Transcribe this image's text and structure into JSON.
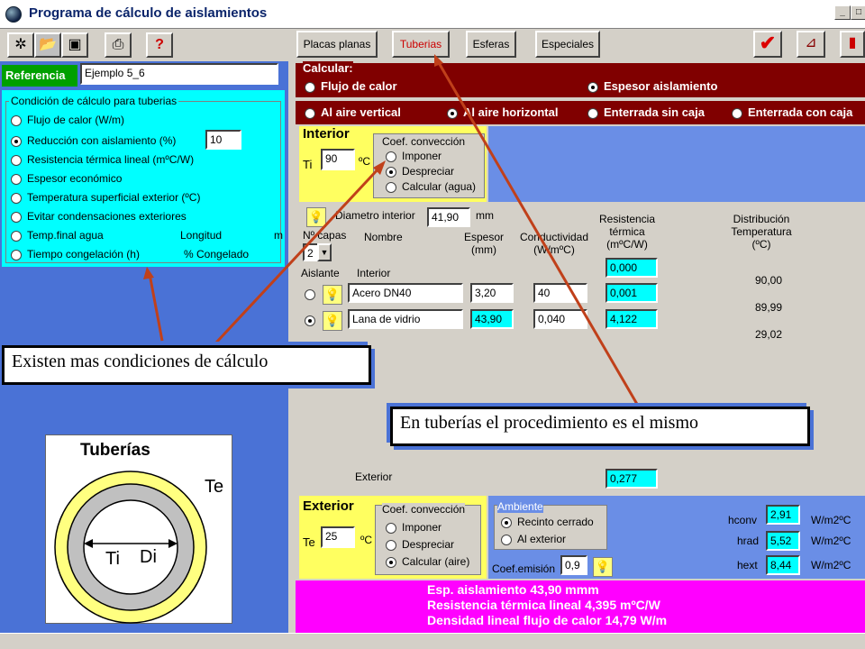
{
  "window": {
    "title": "Programa de cálculo de aislamientos",
    "min": "_",
    "max": "□"
  },
  "toolbar": {
    "tabs": [
      "Placas planas",
      "Tuberias",
      "Esferas",
      "Especiales"
    ]
  },
  "referencia": {
    "label": "Referencia",
    "value": "Ejemplo 5_6"
  },
  "condicion": {
    "title": "Condición de cálculo para tuberias",
    "options": [
      {
        "label": "Flujo de calor  (W/m)",
        "selected": false
      },
      {
        "label": "Reducción con aislamiento (%)",
        "selected": true,
        "value": "10"
      },
      {
        "label": "Resistencia térmica lineal (mºC/W)",
        "selected": false
      },
      {
        "label": "Espesor económico",
        "selected": false
      },
      {
        "label": "Temperatura superficial exterior (ºC)",
        "selected": false
      },
      {
        "label": "Evitar condensaciones exteriores",
        "selected": false
      },
      {
        "label": "Temp.final agua",
        "selected": false,
        "extra1": "Longitud",
        "extra2": "m"
      },
      {
        "label": "Tiempo congelación (h)",
        "selected": false,
        "extra1": "% Congelado"
      }
    ]
  },
  "calcular": {
    "label": "Calcular:",
    "opt1": "Flujo de calor",
    "opt2": "Espesor aislamiento"
  },
  "ambiente_ops": [
    "Al aire vertical",
    "Al aire horizontal",
    "Enterrada sin caja",
    "Enterrada con caja"
  ],
  "interior": {
    "title": "Interior",
    "ti_label": "Ti",
    "ti_value": "90",
    "unit": "ºC",
    "conv_title": "Coef. convección",
    "conv": [
      "Imponer",
      "Despreciar",
      "Calcular (agua)"
    ]
  },
  "table": {
    "diam_label": "Diametro interior",
    "diam_value": "41,90",
    "diam_unit": "mm",
    "ncapas_label": "Nº capas",
    "ncapas_value": "2",
    "h_nombre": "Nombre",
    "h_espesor": "Espesor (mm)",
    "h_cond": "Conductividad (W/mºC)",
    "h_res": "Resistencia térmica (mºC/W)",
    "h_dist": "Distribución Temperatura (ºC)",
    "aislante": "Aislante",
    "interior": "Interior",
    "res_interior": "0,000",
    "t0": "90,00",
    "rows": [
      {
        "name": "Acero DN40",
        "esp": "3,20",
        "cond": "40",
        "res": "0,001",
        "t": "89,99"
      },
      {
        "name": "Lana de vidrio",
        "esp": "43,90",
        "cond": "0,040",
        "res": "4,122",
        "t": "29,02"
      }
    ],
    "exterior": "Exterior",
    "res_ext": "0,277"
  },
  "exterior": {
    "title": "Exterior",
    "te_label": "Te",
    "te_value": "25",
    "unit": "ºC",
    "conv_title": "Coef. convección",
    "conv": [
      "Imponer",
      "Despreciar",
      "Calcular (aire)"
    ],
    "amb_title": "Ambiente",
    "amb": [
      "Recinto cerrado",
      "Al exterior"
    ],
    "emis_label": "Coef.emisión",
    "emis_value": "0,9",
    "hconv": "2,91",
    "hrad": "5,52",
    "hext": "8,44",
    "hconv_l": "hconv",
    "hrad_l": "hrad",
    "hext_l": "hext",
    "unit2": "W/m2ºC"
  },
  "results": [
    "Esp. aislamiento 43,90 mmm",
    "Resistencia térmica lineal 4,395 mºC/W",
    "Densidad lineal flujo de calor 14,79 W/m"
  ],
  "diagram": {
    "title": "Tuberías",
    "te": "Te",
    "ti": "Ti",
    "di": "Di"
  },
  "annotations": {
    "a1": "Existen mas condiciones de cálculo",
    "a2": "En tuberías el procedimiento es el mismo"
  },
  "colors": {
    "arrow": "#c0401a",
    "cyan": "#00ffff",
    "magenta": "#ff00ff",
    "maroon": "#800000"
  }
}
